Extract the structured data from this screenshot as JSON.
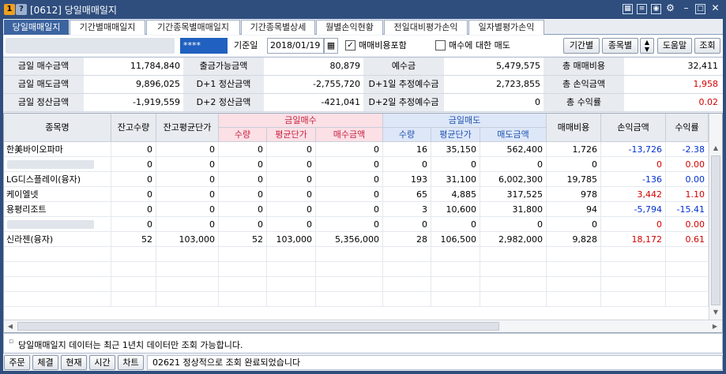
{
  "window": {
    "number": "1",
    "help": "?",
    "title": "[0612] 당일매매일지"
  },
  "titlebar_icons": [
    "calendar-icon",
    "notes-icon",
    "camera-icon",
    "gear-icon",
    "minimize-icon",
    "maximize-icon",
    "close-icon"
  ],
  "tabs": [
    "당일매매일지",
    "기간별매매일지",
    "기간종목별매매일지",
    "기간종목별상세",
    "월별손익현황",
    "전일대비평가손익",
    "일자별평가손익"
  ],
  "toolbar": {
    "password": "****",
    "date_label": "기준일",
    "date_value": "2018/01/19",
    "fee_check_label": "매매비용포함",
    "fee_checked": true,
    "sell_check_label": "매수에 대한 매도",
    "sell_checked": false,
    "period_btn": "기간별",
    "stock_btn": "종목별",
    "help_btn": "도움말",
    "query_btn": "조회"
  },
  "summary": [
    [
      {
        "label": "금일 매수금액",
        "value": "11,784,840"
      },
      {
        "label": "출금가능금액",
        "value": "80,879"
      },
      {
        "label": "예수금",
        "value": "5,479,575"
      },
      {
        "label": "총 매매비용",
        "value": "32,411"
      }
    ],
    [
      {
        "label": "금일 매도금액",
        "value": "9,896,025"
      },
      {
        "label": "D+1 정산금액",
        "value": "-2,755,720"
      },
      {
        "label": "D+1일 추정예수금",
        "value": "2,723,855"
      },
      {
        "label": "총 손익금액",
        "value": "1,958"
      }
    ],
    [
      {
        "label": "금일 정산금액",
        "value": "-1,919,559"
      },
      {
        "label": "D+2 정산금액",
        "value": "-421,041"
      },
      {
        "label": "D+2일 추정예수금",
        "value": "0"
      },
      {
        "label": "총 수익률",
        "value": "0.02"
      }
    ]
  ],
  "grid": {
    "headers": {
      "name": "종목명",
      "qty": "잔고수량",
      "avg": "잔고평균단가",
      "buy_group": "금일매수",
      "sell_group": "금일매도",
      "fee": "매매비용",
      "pl": "손익금액",
      "rate": "수익률"
    },
    "sub_headers": {
      "buy_qty": "수량",
      "buy_avg": "평균단가",
      "buy_amt": "매수금액",
      "sell_qty": "수량",
      "sell_avg": "평균단가",
      "sell_amt": "매도금액"
    },
    "rows": [
      {
        "name": "한美바이오파마",
        "cells": [
          "0",
          "0",
          "0",
          "0",
          "0",
          "16",
          "35,150",
          "562,400",
          "1,726",
          "-13,726",
          "-2.38"
        ],
        "pl_color": "blue"
      },
      {
        "name": "",
        "cells": [
          "0",
          "0",
          "0",
          "0",
          "0",
          "0",
          "0",
          "0",
          "0",
          "0",
          "0.00"
        ],
        "pl_color": "red",
        "blurred": true
      },
      {
        "name": "LG디스플레이(융자)",
        "cells": [
          "0",
          "0",
          "0",
          "0",
          "0",
          "193",
          "31,100",
          "6,002,300",
          "19,785",
          "-136",
          "0.00"
        ],
        "pl_color": "blue"
      },
      {
        "name": "케이엘넷",
        "cells": [
          "0",
          "0",
          "0",
          "0",
          "0",
          "65",
          "4,885",
          "317,525",
          "978",
          "3,442",
          "1.10"
        ],
        "pl_color": "red"
      },
      {
        "name": "용평리조트",
        "cells": [
          "0",
          "0",
          "0",
          "0",
          "0",
          "3",
          "10,600",
          "31,800",
          "94",
          "-5,794",
          "-15.41"
        ],
        "pl_color": "blue"
      },
      {
        "name": "",
        "cells": [
          "0",
          "0",
          "0",
          "0",
          "0",
          "0",
          "0",
          "0",
          "0",
          "0",
          "0.00"
        ],
        "pl_color": "red",
        "blurred": true
      },
      {
        "name": "신라젠(융자)",
        "cells": [
          "52",
          "103,000",
          "52",
          "103,000",
          "5,356,000",
          "28",
          "106,500",
          "2,982,000",
          "9,828",
          "18,172",
          "0.61"
        ],
        "pl_color": "red"
      }
    ]
  },
  "notice": "당일매매일지 데이터는 최근 1년치 데이터만 조회 가능합니다.",
  "status": {
    "order_btn": "주문",
    "exec_btn": "체결",
    "current_btn": "현재",
    "time_btn": "시간",
    "chart_btn": "차트",
    "message": "02621 정상적으로 조회 완료되었습니다"
  },
  "colors": {
    "titlebar": "#2f4e7e",
    "active_tab": "#3c64a0",
    "positive": "#d20000",
    "negative": "#0030d0"
  }
}
